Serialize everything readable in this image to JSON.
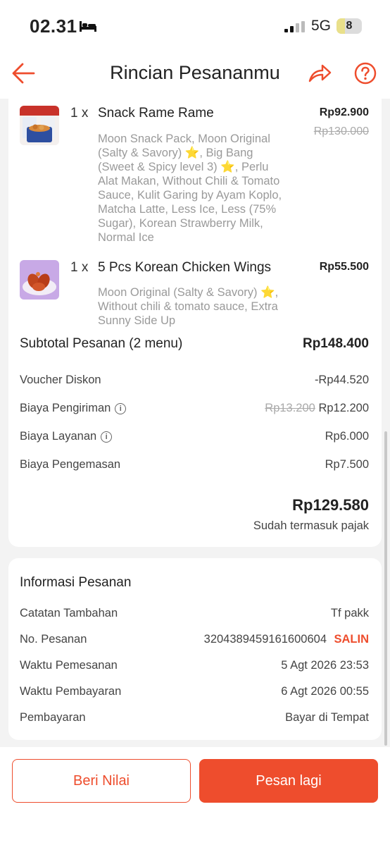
{
  "status": {
    "time": "02.31",
    "network": "5G",
    "battery": "8"
  },
  "header": {
    "title": "Rincian Pesananmu"
  },
  "items": [
    {
      "qty": "1 x",
      "name": "Snack Rame Rame",
      "price": "Rp92.900",
      "original_price": "Rp130.000",
      "desc_lines": [
        "Moon Snack Pack, Moon Original",
        "(Salty & Savory) ⭐, Big Bang",
        "(Sweet & Spicy level 3) ⭐, Perlu",
        "Alat Makan, Without Chili & Tomato",
        "Sauce, Kulit Garing by Ayam Koplo,",
        "Matcha Latte, Less Ice, Less (75%",
        "Sugar), Korean Strawberry Milk,",
        "Normal Ice"
      ]
    },
    {
      "qty": "1 x",
      "name": "5 Pcs Korean Chicken Wings",
      "price": "Rp55.500",
      "desc_lines": [
        "Moon Original (Salty & Savory) ⭐,",
        "Without chili & tomato sauce, Extra",
        "Sunny Side Up"
      ]
    }
  ],
  "summary": {
    "subtotal_label": "Subtotal Pesanan (2 menu)",
    "subtotal_value": "Rp148.400",
    "voucher_label": "Voucher Diskon",
    "voucher_value": "-Rp44.520",
    "delivery_label": "Biaya Pengiriman",
    "delivery_original": "Rp13.200",
    "delivery_value": "Rp12.200",
    "service_label": "Biaya Layanan",
    "service_value": "Rp6.000",
    "packaging_label": "Biaya Pengemasan",
    "packaging_value": "Rp7.500",
    "total": "Rp129.580",
    "tax_note": "Sudah termasuk pajak"
  },
  "order_info": {
    "heading": "Informasi Pesanan",
    "notes_label": "Catatan Tambahan",
    "notes_value": "Tf pakk",
    "order_no_label": "No. Pesanan",
    "order_no_value": "3204389459161600604",
    "copy_label": "SALIN",
    "order_time_label": "Waktu Pemesanan",
    "order_time_value": "5 Agt 2026 23:53",
    "payment_time_label": "Waktu Pembayaran",
    "payment_time_value": "6 Agt 2026 00:55",
    "payment_label": "Pembayaran",
    "payment_value": "Bayar di Tempat"
  },
  "footer": {
    "rate_label": "Beri Nilai",
    "reorder_label": "Pesan lagi"
  },
  "colors": {
    "accent": "#ee4d2d",
    "background": "#f3f3f3"
  },
  "icons": [
    "back-arrow-icon",
    "share-icon",
    "help-icon",
    "info-icon",
    "bed-icon",
    "signal-icon"
  ]
}
